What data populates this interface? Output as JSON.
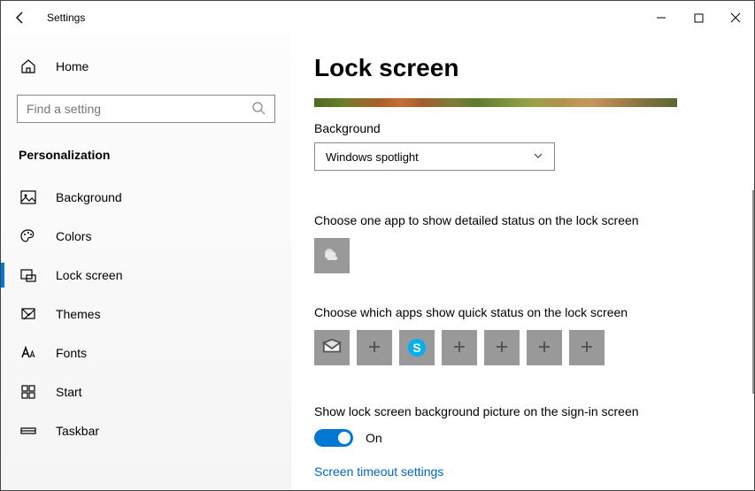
{
  "window": {
    "title": "Settings"
  },
  "home_label": "Home",
  "search": {
    "placeholder": "Find a setting"
  },
  "section_header": "Personalization",
  "nav": {
    "items": [
      {
        "id": "background",
        "label": "Background"
      },
      {
        "id": "colors",
        "label": "Colors"
      },
      {
        "id": "lockscreen",
        "label": "Lock screen"
      },
      {
        "id": "themes",
        "label": "Themes"
      },
      {
        "id": "fonts",
        "label": "Fonts"
      },
      {
        "id": "start",
        "label": "Start"
      },
      {
        "id": "taskbar",
        "label": "Taskbar"
      }
    ],
    "active_id": "lockscreen"
  },
  "page": {
    "title": "Lock screen",
    "background_label": "Background",
    "background_value": "Windows spotlight",
    "detailed_status_label": "Choose one app to show detailed status on the lock screen",
    "detailed_status_app": "weather",
    "quick_status_label": "Choose which apps show quick status on the lock screen",
    "quick_status_slots": [
      "mail",
      "empty",
      "skype",
      "empty",
      "empty",
      "empty",
      "empty"
    ],
    "signin_picture_label": "Show lock screen background picture on the sign-in screen",
    "signin_picture_state": "On",
    "timeout_link": "Screen timeout settings"
  }
}
